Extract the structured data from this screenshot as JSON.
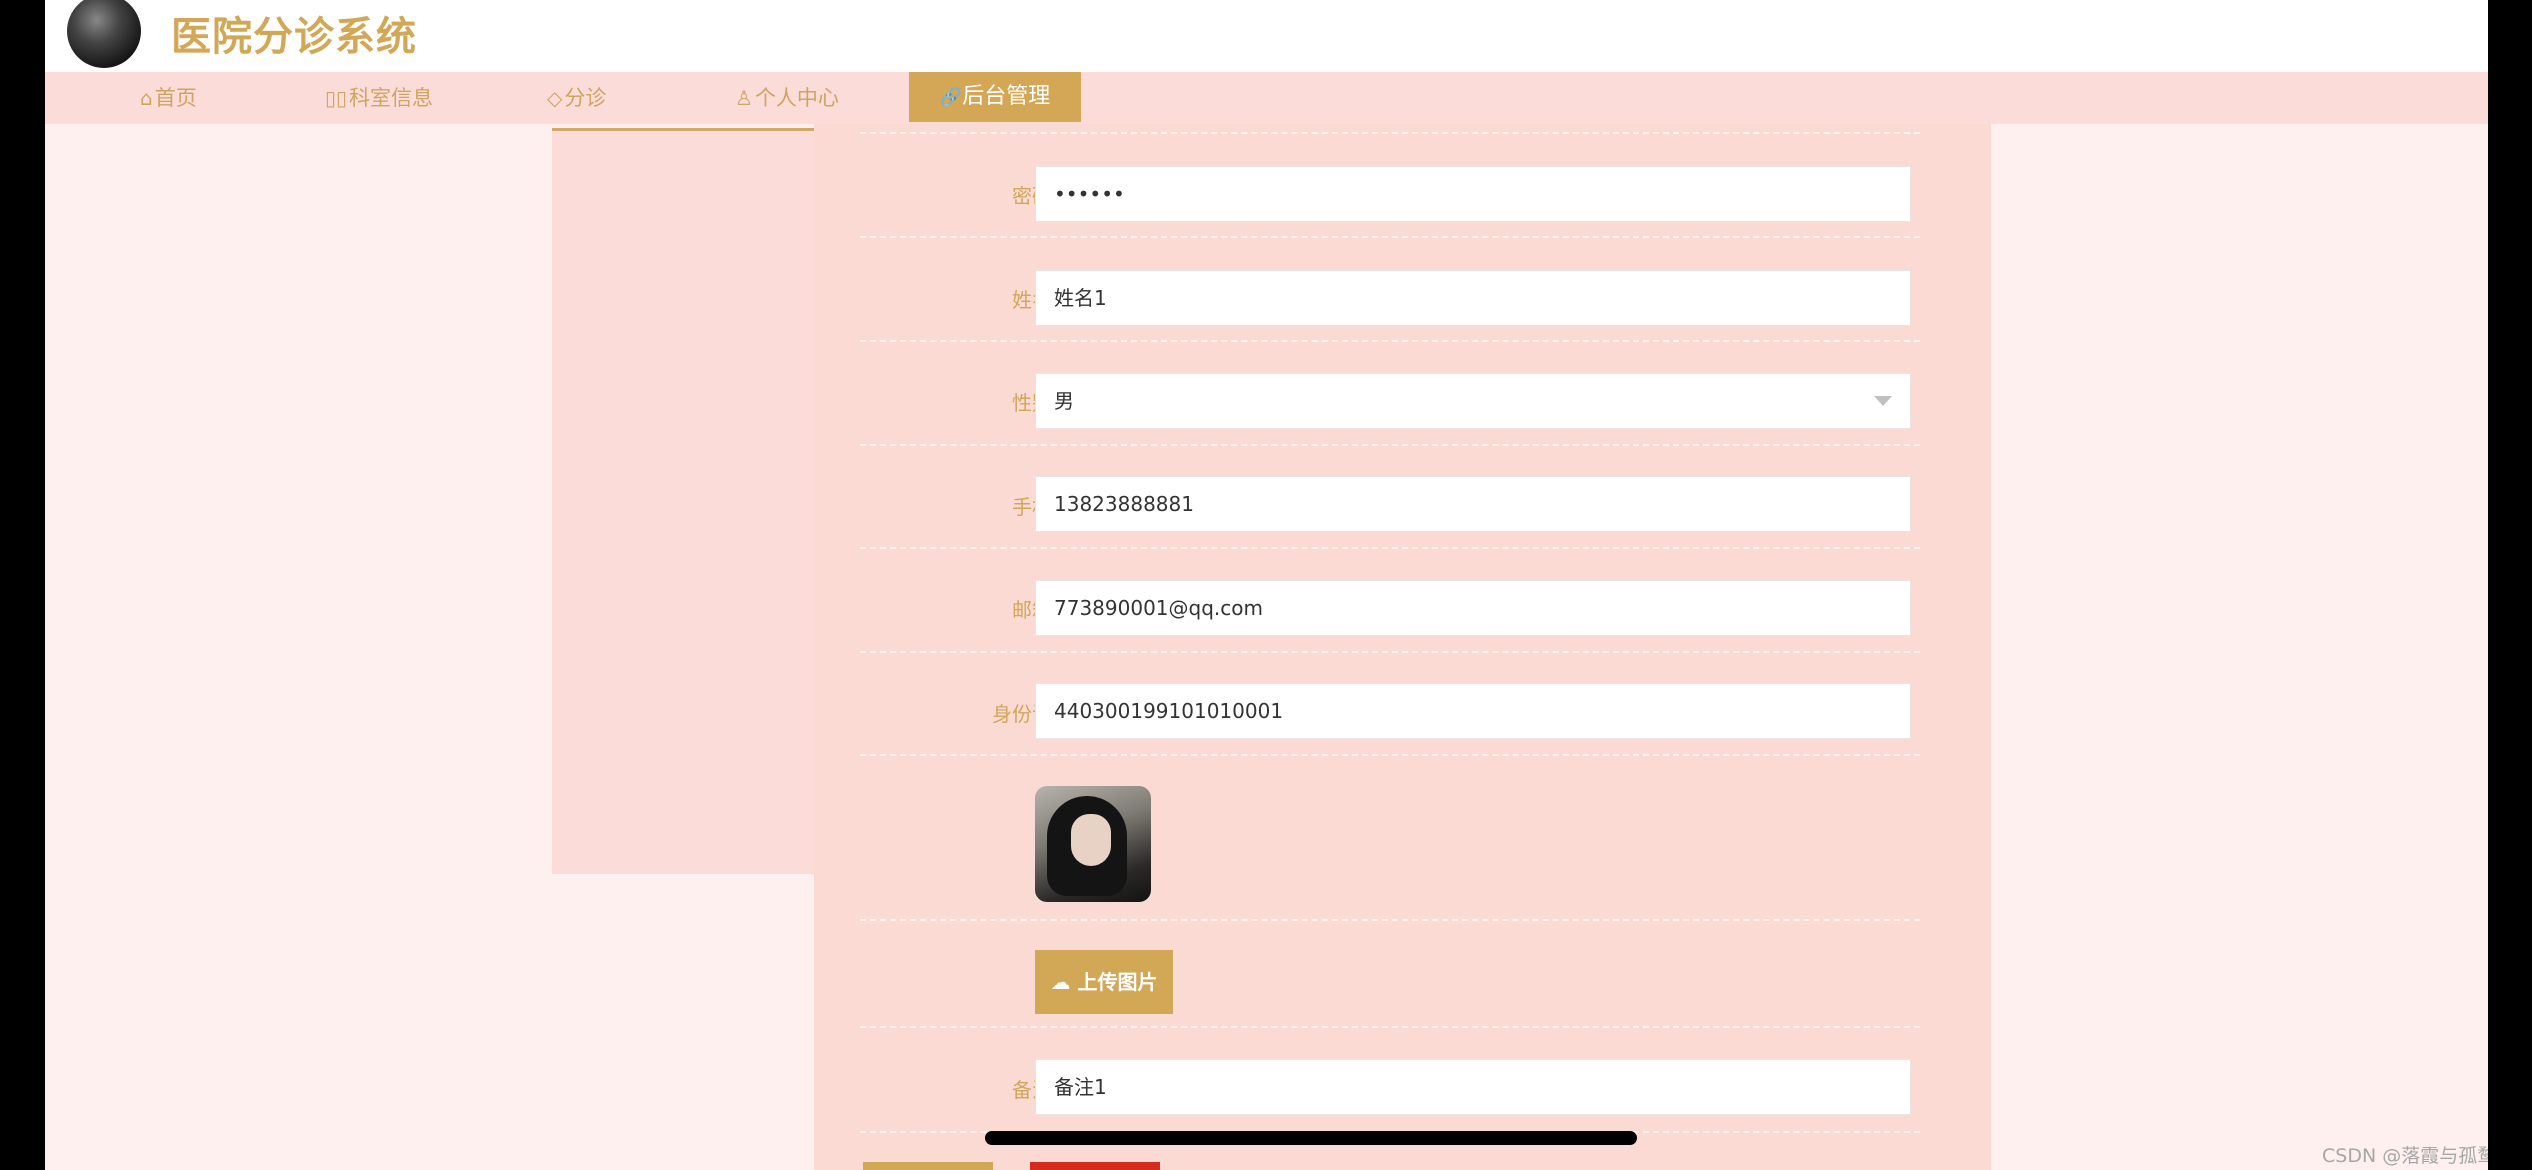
{
  "app": {
    "title": "医院分诊系统"
  },
  "nav": {
    "items": [
      {
        "icon": "⌂",
        "label": "首页"
      },
      {
        "icon": "▯▯",
        "label": "科室信息"
      },
      {
        "icon": "◇",
        "label": "分诊"
      },
      {
        "icon": "♙",
        "label": "个人中心"
      }
    ],
    "active": {
      "icon": "🔗",
      "label": "后台管理"
    }
  },
  "form": {
    "password": {
      "label": "密码",
      "value": "••••••"
    },
    "name": {
      "label": "姓名",
      "value": "姓名1"
    },
    "gender": {
      "label": "性别",
      "value": "男"
    },
    "phone": {
      "label": "手机",
      "value": "13823888881"
    },
    "email": {
      "label": "邮箱",
      "value": "773890001@qq.com"
    },
    "idcard": {
      "label": "身份证",
      "value": "440300199101010001"
    },
    "upload_label": "上传图片",
    "remark": {
      "label": "备注",
      "value": "备注1"
    }
  },
  "watermark": "CSDN @落霞与孤鹜齐飞。。"
}
